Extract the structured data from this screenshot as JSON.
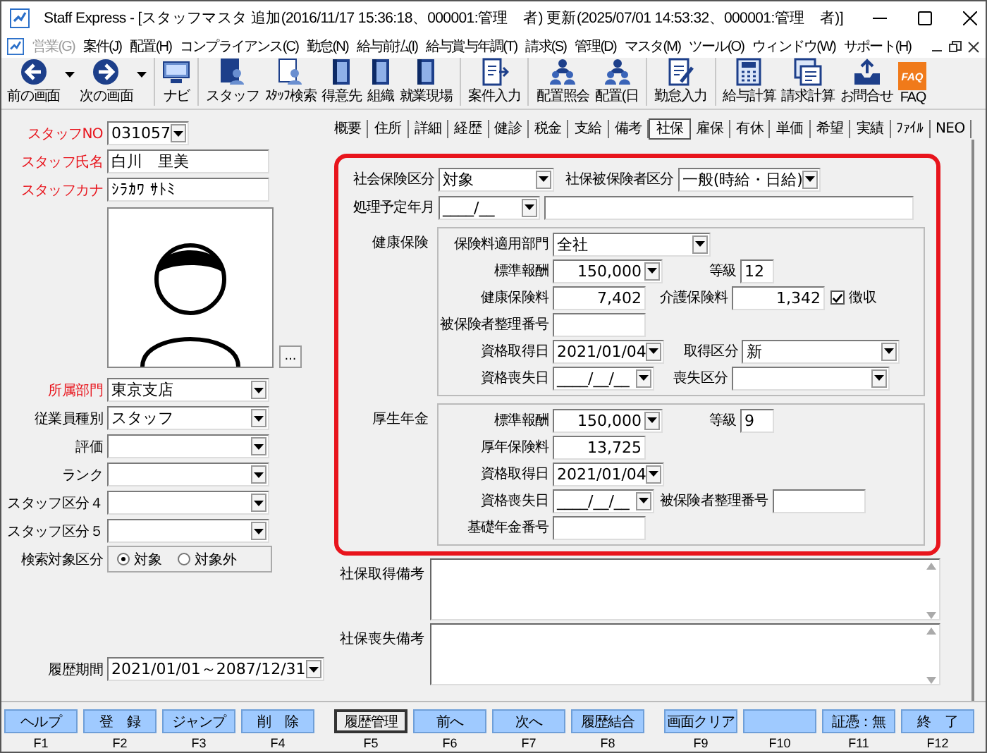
{
  "window": {
    "title": "Staff Express - [スタッフマスタ 追加(2016/11/17 15:36:18、000001:管理　者) 更新(2025/07/01 14:53:32、000001:管理　者)]"
  },
  "menu": [
    {
      "label": "営業(G)",
      "disabled": true
    },
    {
      "label": "案件(J)",
      "disabled": false
    },
    {
      "label": "配置(H)",
      "disabled": false
    },
    {
      "label": "コンプライアンス(C)",
      "disabled": false
    },
    {
      "label": "勤怠(N)",
      "disabled": false
    },
    {
      "label": "給与前払(I)",
      "disabled": false
    },
    {
      "label": "給与賞与年調(T)",
      "disabled": false
    },
    {
      "label": "請求(S)",
      "disabled": false
    },
    {
      "label": "管理(D)",
      "disabled": false
    },
    {
      "label": "マスタ(M)",
      "disabled": false
    },
    {
      "label": "ツール(O)",
      "disabled": false
    },
    {
      "label": "ウィンドウ(W)",
      "disabled": false
    },
    {
      "label": "サポート(H)",
      "disabled": false
    }
  ],
  "toolbar": [
    {
      "label": "前の画面",
      "kind": "back",
      "dropdown": true,
      "separator_before": false
    },
    {
      "label": "次の画面",
      "kind": "forward",
      "dropdown": true,
      "separator_before": false
    },
    {
      "label": "ナビ",
      "kind": "navi",
      "dropdown": false,
      "separator_before": true
    },
    {
      "label": "スタッフ",
      "kind": "staff",
      "dropdown": false,
      "separator_before": true
    },
    {
      "label": "ｽﾀｯﾌ検索",
      "kind": "staff-search",
      "dropdown": false,
      "separator_before": false
    },
    {
      "label": "得意先",
      "kind": "binder",
      "dropdown": false,
      "separator_before": false
    },
    {
      "label": "組織",
      "kind": "binder",
      "dropdown": false,
      "separator_before": false
    },
    {
      "label": "就業現場",
      "kind": "binder",
      "dropdown": false,
      "separator_before": false
    },
    {
      "label": "案件入力",
      "kind": "job",
      "dropdown": false,
      "separator_before": true
    },
    {
      "label": "配置照会",
      "kind": "people",
      "dropdown": false,
      "separator_before": true
    },
    {
      "label": "配置(日",
      "kind": "people",
      "dropdown": false,
      "separator_before": false
    },
    {
      "label": "勤怠入力",
      "kind": "attendance",
      "dropdown": false,
      "separator_before": true
    },
    {
      "label": "給与計算",
      "kind": "payroll",
      "dropdown": false,
      "separator_before": true
    },
    {
      "label": "請求計算",
      "kind": "billing",
      "dropdown": false,
      "separator_before": false
    },
    {
      "label": "お問合せ",
      "kind": "inquiry",
      "dropdown": false,
      "separator_before": false
    },
    {
      "label": "FAQ",
      "kind": "faq",
      "icon_text": "FAQ",
      "dropdown": false,
      "separator_before": false
    }
  ],
  "staff": {
    "top_fields": [
      {
        "label": "スタッフNO",
        "value": "031057",
        "kind": "short-select",
        "required": true
      },
      {
        "label": "スタッフ氏名",
        "value": "白川　里美",
        "kind": "input",
        "required": true
      },
      {
        "label": "スタッフカナ",
        "value": "ｼﾗｶﾜ ｻﾄﾐ",
        "kind": "input",
        "required": true
      }
    ],
    "photo_button": "...",
    "fields": [
      {
        "label": "所属部門",
        "value": "東京支店",
        "kind": "select",
        "required": true
      },
      {
        "label": "従業員種別",
        "value": "スタッフ",
        "kind": "select",
        "required": false
      },
      {
        "label": "評価",
        "kind": "select",
        "required": false
      },
      {
        "label": "ランク",
        "kind": "select",
        "required": false
      },
      {
        "label": "スタッフ区分４",
        "kind": "select",
        "required": false
      },
      {
        "label": "スタッフ区分５",
        "kind": "select",
        "required": false
      }
    ],
    "search_target": {
      "label": "検索対象区分",
      "options": [
        {
          "label": "対象",
          "selected": true
        },
        {
          "label": "対象外",
          "selected": false
        }
      ]
    },
    "history_period": {
      "label": "履歴期間",
      "value": "2021/01/01～2087/12/31"
    }
  },
  "tabs": [
    {
      "label": "概要",
      "selected": false
    },
    {
      "label": "住所",
      "selected": false
    },
    {
      "label": "詳細",
      "selected": false
    },
    {
      "label": "経歴",
      "selected": false
    },
    {
      "label": "健診",
      "selected": false
    },
    {
      "label": "税金",
      "selected": false
    },
    {
      "label": "支給",
      "selected": false
    },
    {
      "label": "備考",
      "selected": false
    },
    {
      "label": "社保",
      "selected": true
    },
    {
      "label": "雇保",
      "selected": false
    },
    {
      "label": "有休",
      "selected": false
    },
    {
      "label": "単価",
      "selected": false
    },
    {
      "label": "希望",
      "selected": false
    },
    {
      "label": "実績",
      "selected": false
    },
    {
      "label": "ﾌｧｲﾙ",
      "selected": false
    },
    {
      "label": "NEO",
      "selected": false
    }
  ],
  "insurance": {
    "rows": [
      [
        {
          "label": "社会保険区分",
          "kind": "select",
          "value": "対象"
        },
        {
          "label": "社保被保険者区分",
          "kind": "select",
          "value": "一般(時給・日給)"
        }
      ],
      [
        {
          "label": "処理予定年月",
          "kind": "date-select",
          "value": "____/__"
        },
        {
          "kind": "wide-input"
        }
      ]
    ],
    "groups": [
      {
        "title": "健康保険",
        "rows": [
          [
            {
              "label": "保険料適用部門",
              "kind": "wide-select",
              "value": "全社"
            }
          ],
          [
            {
              "label": "標準報酬",
              "kind": "amount-select",
              "value": "150,000"
            },
            {
              "label": "等級",
              "kind": "grade",
              "value": "12"
            }
          ],
          [
            {
              "label": "健康保険料",
              "kind": "amount",
              "value": "7,402"
            },
            {
              "label": "介護保険料",
              "kind": "amount",
              "value": "1,342"
            },
            {
              "label": "徴収",
              "kind": "checkbox",
              "checked": true
            }
          ],
          [
            {
              "label": "被保険者整理番号",
              "kind": "input"
            }
          ],
          [
            {
              "label": "資格取得日",
              "kind": "date-select",
              "value": "2021/01/04"
            },
            {
              "label": "取得区分",
              "kind": "wide-select",
              "value": "新"
            }
          ],
          [
            {
              "label": "資格喪失日",
              "kind": "date-select",
              "value": "____/__/__"
            },
            {
              "label": "喪失区分",
              "kind": "wide-select"
            }
          ]
        ]
      },
      {
        "title": "厚生年金",
        "rows": [
          [
            {
              "label": "標準報酬",
              "kind": "amount-select",
              "value": "150,000"
            },
            {
              "label": "等級",
              "kind": "grade",
              "value": "9"
            }
          ],
          [
            {
              "label": "厚年保険料",
              "kind": "amount",
              "value": "13,725"
            }
          ],
          [
            {
              "label": "資格取得日",
              "kind": "date-select",
              "value": "2021/01/04"
            }
          ],
          [
            {
              "label": "資格喪失日",
              "kind": "date-select",
              "value": "____/__/__"
            },
            {
              "label": "被保険者整理番号",
              "kind": "input"
            }
          ],
          [
            {
              "label": "基礎年金番号",
              "kind": "input"
            }
          ]
        ]
      }
    ],
    "notes": [
      {
        "label": "社保取得備考"
      },
      {
        "label": "社保喪失備考"
      }
    ]
  },
  "function_keys": [
    {
      "label": "ヘルプ",
      "key": "F1",
      "focused": false
    },
    {
      "label": "登　録",
      "key": "F2",
      "focused": false
    },
    {
      "label": "ジャンプ",
      "key": "F3",
      "focused": false
    },
    {
      "label": "削　除",
      "key": "F4",
      "focused": false
    },
    {
      "label": "履歴管理",
      "key": "F5",
      "focused": true
    },
    {
      "label": "前へ",
      "key": "F6",
      "focused": false
    },
    {
      "label": "次へ",
      "key": "F7",
      "focused": false
    },
    {
      "label": "履歴結合",
      "key": "F8",
      "focused": false
    },
    {
      "label": "画面クリア",
      "key": "F9",
      "focused": false
    },
    {
      "key": "F10",
      "focused": false
    },
    {
      "label": "証憑：無",
      "key": "F11",
      "focused": false
    },
    {
      "label": "終　了",
      "key": "F12",
      "focused": false
    }
  ]
}
